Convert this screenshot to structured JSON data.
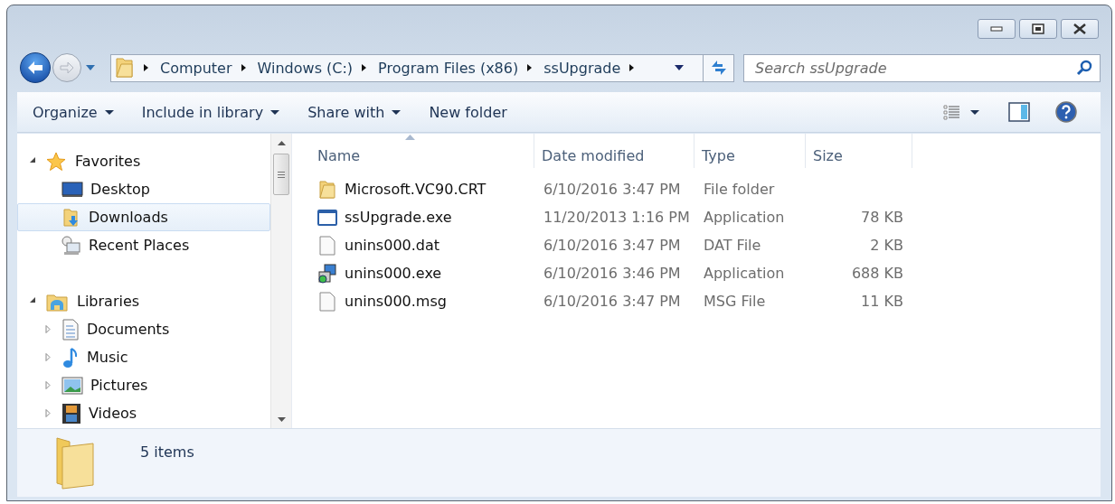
{
  "address": {
    "crumbs": [
      "Computer",
      "Windows (C:)",
      "Program Files (x86)",
      "ssUpgrade"
    ]
  },
  "search": {
    "placeholder": "Search ssUpgrade"
  },
  "toolbar": {
    "items": [
      {
        "label": "Organize",
        "dropdown": true
      },
      {
        "label": "Include in library",
        "dropdown": true
      },
      {
        "label": "Share with",
        "dropdown": true
      },
      {
        "label": "New folder",
        "dropdown": false
      }
    ]
  },
  "nav": {
    "sections": [
      {
        "label": "Favorites",
        "kind": "star",
        "expanded": true,
        "children": [
          {
            "label": "Desktop",
            "kind": "desktop",
            "selected": false
          },
          {
            "label": "Downloads",
            "kind": "downloads",
            "selected": true
          },
          {
            "label": "Recent Places",
            "kind": "recent",
            "selected": false
          }
        ]
      },
      {
        "label": "Libraries",
        "kind": "library",
        "expanded": true,
        "children": [
          {
            "label": "Documents",
            "kind": "document",
            "selected": false,
            "expanded": false
          },
          {
            "label": "Music",
            "kind": "music",
            "selected": false,
            "expanded": false
          },
          {
            "label": "Pictures",
            "kind": "pictures",
            "selected": false,
            "expanded": false
          },
          {
            "label": "Videos",
            "kind": "videos",
            "selected": false,
            "expanded": false
          }
        ]
      }
    ]
  },
  "files": {
    "columns": [
      {
        "label": "Name",
        "sorted": true
      },
      {
        "label": "Date modified",
        "sorted": false
      },
      {
        "label": "Type",
        "sorted": false
      },
      {
        "label": "Size",
        "sorted": false
      }
    ],
    "rows": [
      {
        "kind": "folder",
        "name": "Microsoft.VC90.CRT",
        "date": "6/10/2016 3:47 PM",
        "type": "File folder"
      },
      {
        "kind": "app",
        "name": "ssUpgrade.exe",
        "date": "11/20/2013 1:16 PM",
        "type": "Application",
        "size": "78 KB"
      },
      {
        "kind": "file",
        "name": "unins000.dat",
        "date": "6/10/2016 3:47 PM",
        "type": "DAT File",
        "size": "2 KB"
      },
      {
        "kind": "installer",
        "name": "unins000.exe",
        "date": "6/10/2016 3:46 PM",
        "type": "Application",
        "size": "688 KB"
      },
      {
        "kind": "file",
        "name": "unins000.msg",
        "date": "6/10/2016 3:47 PM",
        "type": "MSG File",
        "size": "11 KB"
      }
    ]
  },
  "status_bar": {
    "count": "5 items"
  }
}
